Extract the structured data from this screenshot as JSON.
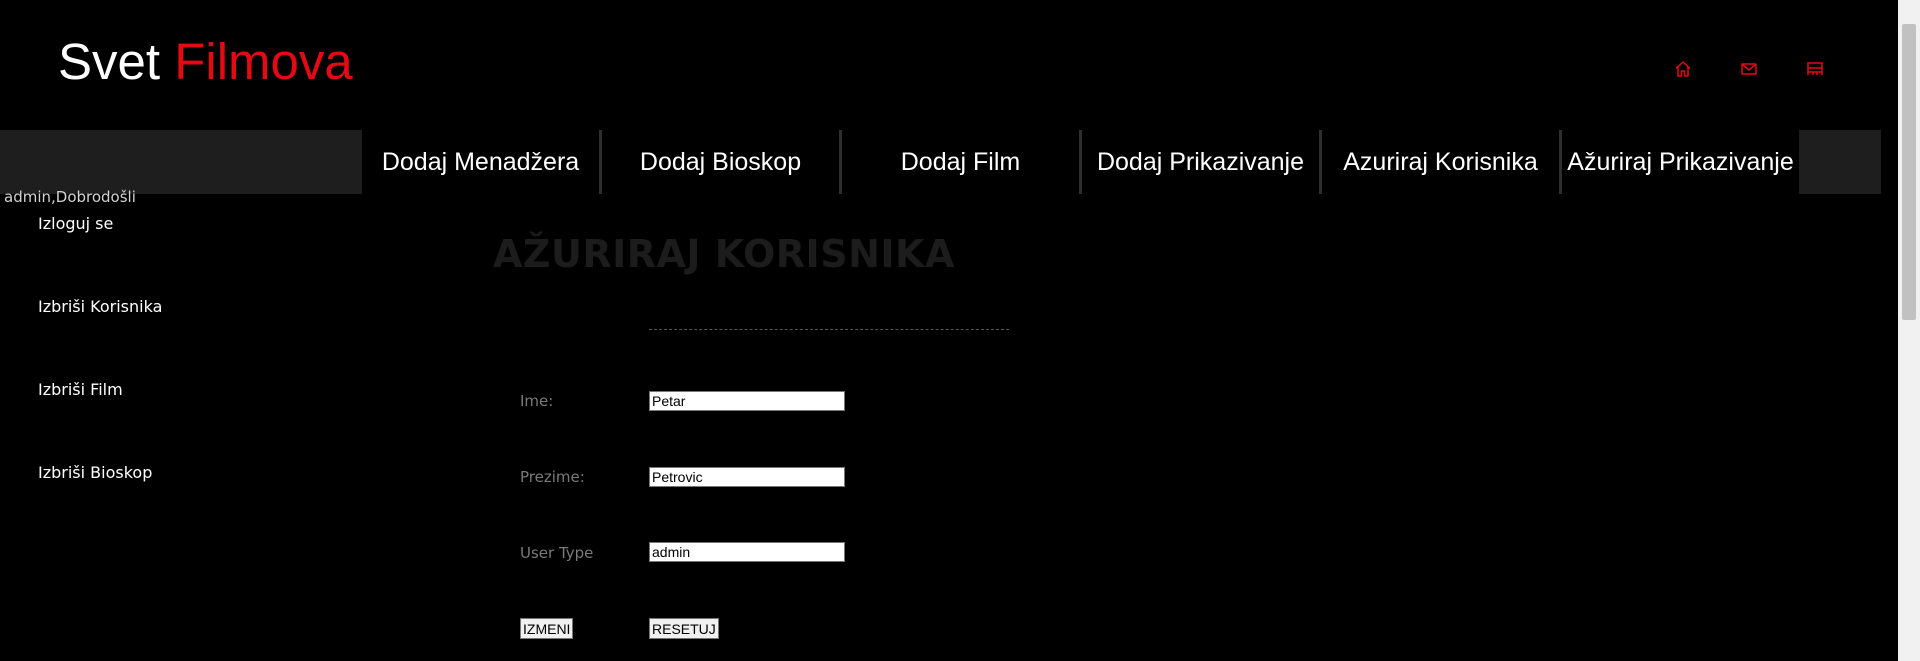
{
  "brand": {
    "word1": "Svet",
    "word2": "Filmova",
    "accent_color": "#e50914"
  },
  "header_icons": [
    "home-icon",
    "mail-icon",
    "cinema-icon"
  ],
  "nav": {
    "items": [
      {
        "label": "Dodaj Menadžera"
      },
      {
        "label": "Dodaj Bioskop"
      },
      {
        "label": "Dodaj Film"
      },
      {
        "label": "Dodaj Prikazivanje"
      },
      {
        "label": "Azuriraj Korisnika"
      },
      {
        "label": "Ažuriraj Prikazivanje"
      }
    ]
  },
  "welcome": "admin,Dobrodošli",
  "sidebar": {
    "items": [
      {
        "label": "Izloguj se"
      },
      {
        "label": "Izbriši Korisnika"
      },
      {
        "label": "Izbriši Film"
      },
      {
        "label": "Izbriši Bioskop"
      }
    ]
  },
  "form": {
    "title": "AŽURIRAJ KORISNIKA",
    "fields": [
      {
        "label": "Ime:",
        "value": "Petar"
      },
      {
        "label": "Prezime:",
        "value": "Petrovic"
      },
      {
        "label": "User Type",
        "value": "admin"
      }
    ],
    "submit_label": "IZMENI",
    "reset_label": "RESETUJ"
  }
}
